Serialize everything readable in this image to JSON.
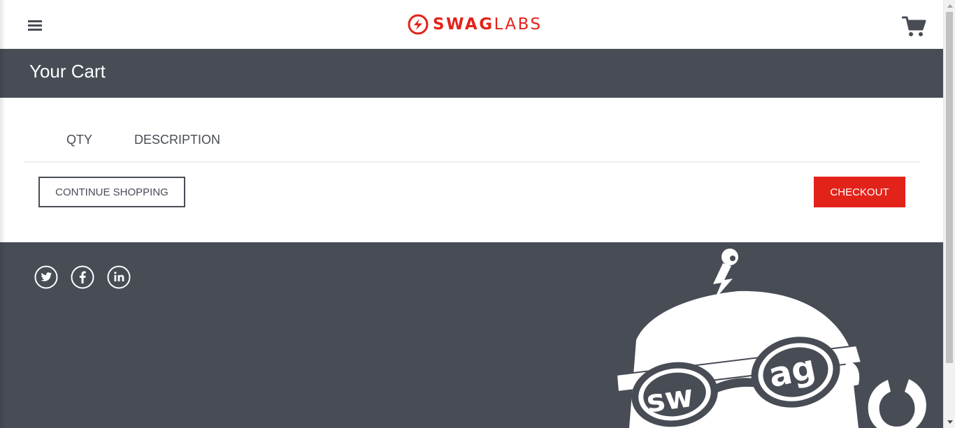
{
  "header": {
    "logo_bold": "SWAG",
    "logo_light": "LABS",
    "menu_icon": "hamburger-menu-icon",
    "cart_icon": "shopping-cart-icon"
  },
  "subheader": {
    "title": "Your Cart"
  },
  "cart": {
    "qty_label": "QTY",
    "description_label": "DESCRIPTION",
    "continue_label": "CONTINUE SHOPPING",
    "checkout_label": "CHECKOUT"
  },
  "footer": {
    "social": [
      "twitter-icon",
      "facebook-icon",
      "linkedin-icon"
    ],
    "mascot_text": "swag"
  },
  "colors": {
    "brand_red": "#e2231a",
    "dark_gray": "#474c55",
    "text_dark": "#484c55",
    "white": "#ffffff"
  }
}
